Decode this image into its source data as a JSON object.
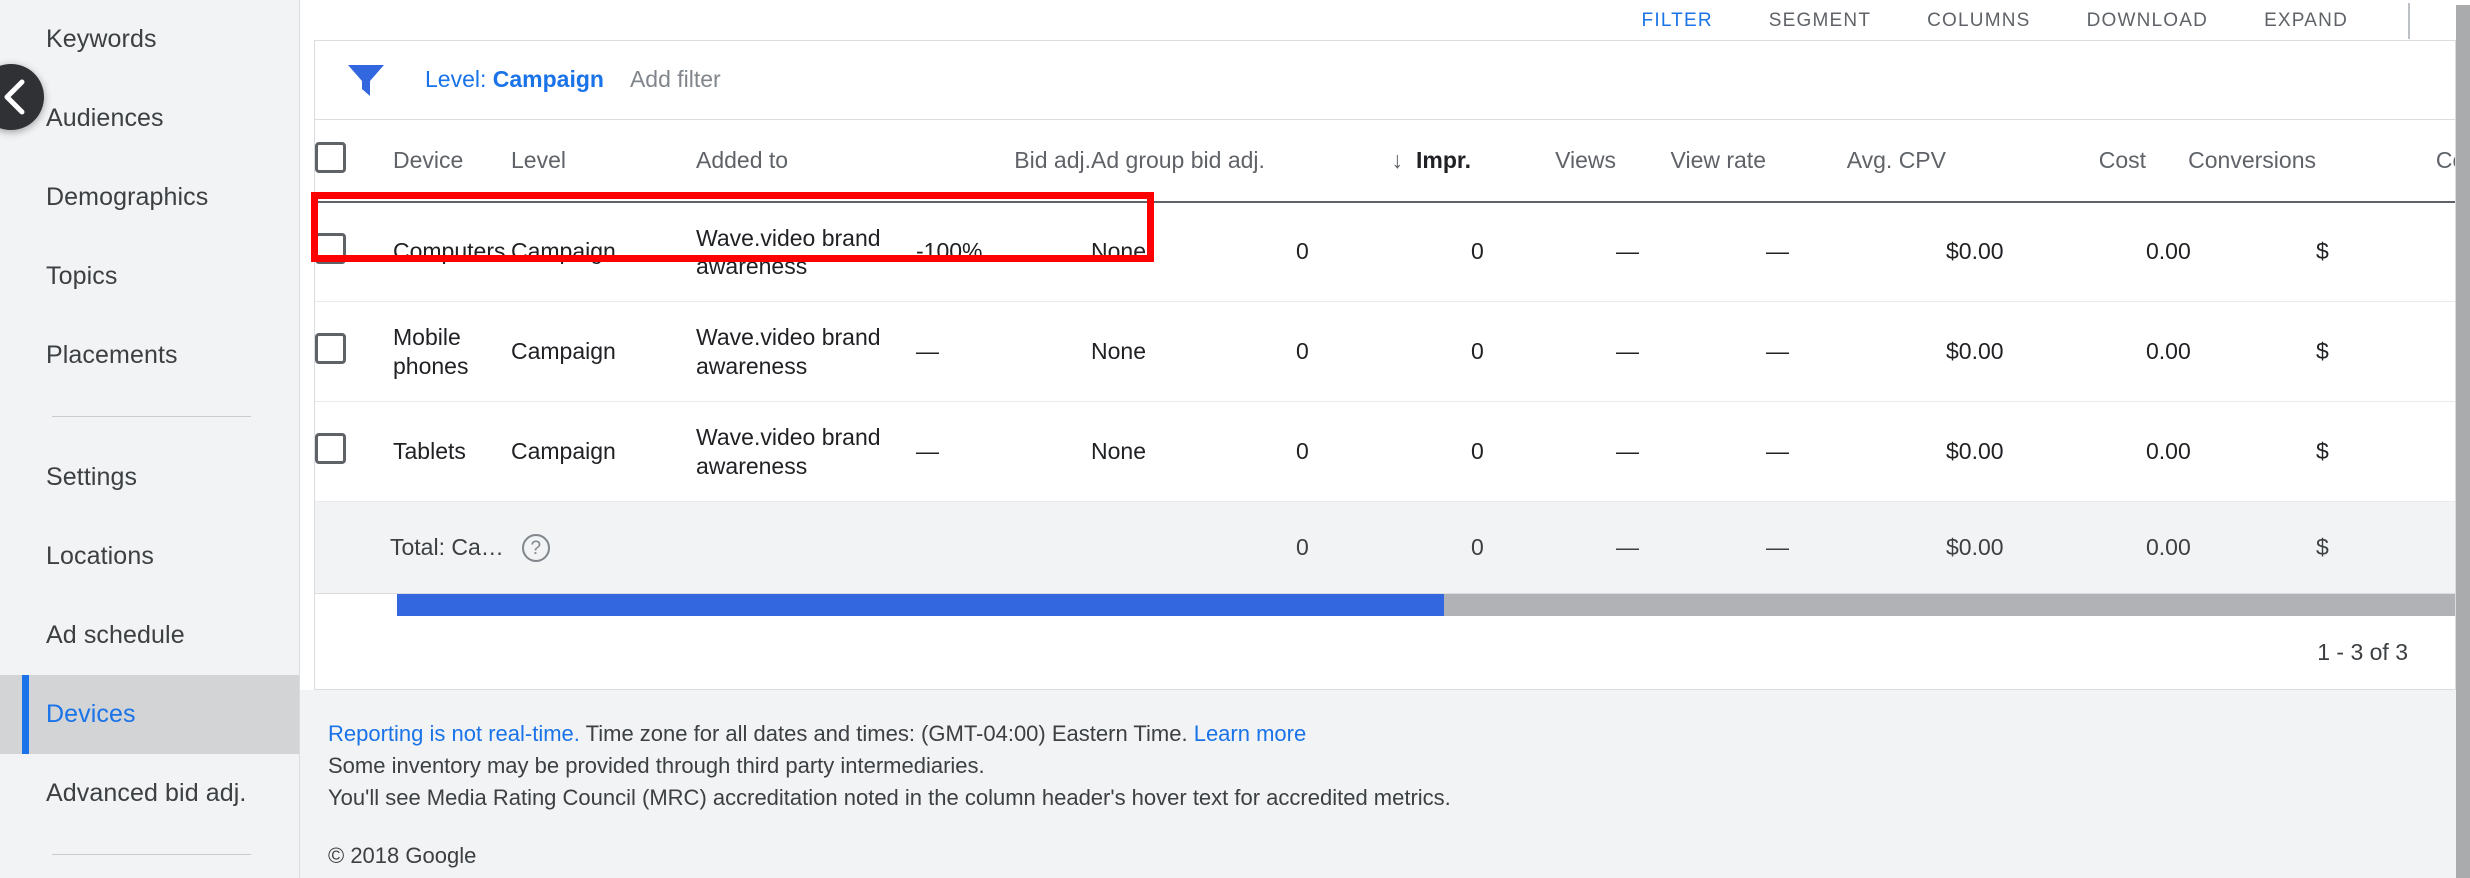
{
  "sidebar": {
    "collapse_icon": "chevron-left-icon",
    "items": [
      {
        "label": "Keywords",
        "active": false,
        "divider_after": false
      },
      {
        "label": "Audiences",
        "active": false,
        "divider_after": false
      },
      {
        "label": "Demographics",
        "active": false,
        "divider_after": false
      },
      {
        "label": "Topics",
        "active": false,
        "divider_after": false
      },
      {
        "label": "Placements",
        "active": false,
        "divider_after": true
      },
      {
        "label": "Settings",
        "active": false,
        "divider_after": false
      },
      {
        "label": "Locations",
        "active": false,
        "divider_after": false
      },
      {
        "label": "Ad schedule",
        "active": false,
        "divider_after": false
      },
      {
        "label": "Devices",
        "active": true,
        "divider_after": false
      },
      {
        "label": "Advanced bid adj.",
        "active": false,
        "divider_after": true
      }
    ]
  },
  "toolbar": {
    "buttons": [
      {
        "label": "FILTER",
        "accent": true
      },
      {
        "label": "SEGMENT",
        "accent": false
      },
      {
        "label": "COLUMNS",
        "accent": false
      },
      {
        "label": "DOWNLOAD",
        "accent": false
      },
      {
        "label": "EXPAND",
        "accent": false
      }
    ]
  },
  "filter_bar": {
    "funnel_icon": "filter-funnel-icon",
    "chip_prefix": "Level: ",
    "chip_value": "Campaign",
    "add_filter_label": "Add filter"
  },
  "table": {
    "sort_arrow": "↓",
    "columns": [
      {
        "key": "device",
        "label": "Device",
        "align": "left",
        "sorted": false
      },
      {
        "key": "level",
        "label": "Level",
        "align": "left",
        "sorted": false
      },
      {
        "key": "added_to",
        "label": "Added to",
        "align": "left",
        "sorted": false
      },
      {
        "key": "bid_adj",
        "label": "Bid adj.",
        "align": "right",
        "sorted": false
      },
      {
        "key": "ag_bid",
        "label": "Ad group bid adj.",
        "align": "left",
        "sorted": false
      },
      {
        "key": "impr",
        "label": "Impr.",
        "align": "right",
        "sorted": true
      },
      {
        "key": "views",
        "label": "Views",
        "align": "right",
        "sorted": false
      },
      {
        "key": "view_rate",
        "label": "View rate",
        "align": "right",
        "sorted": false
      },
      {
        "key": "avg_cpv",
        "label": "Avg. CPV",
        "align": "right",
        "sorted": false
      },
      {
        "key": "cost",
        "label": "Cost",
        "align": "right",
        "sorted": false
      },
      {
        "key": "conv",
        "label": "Conversions",
        "align": "right",
        "sorted": false
      },
      {
        "key": "cost_conv",
        "label": "Cost /",
        "align": "right",
        "sorted": false
      }
    ],
    "rows": [
      {
        "device": "Computers",
        "level": "Campaign",
        "added_to": "Wave.video brand awareness",
        "bid_adj": "-100%",
        "ag_bid": "None",
        "impr": "0",
        "views": "0",
        "view_rate": "—",
        "avg_cpv": "—",
        "cost": "$0.00",
        "conv": "0.00",
        "cost_conv": "$",
        "highlighted": true
      },
      {
        "device": "Mobile phones",
        "level": "Campaign",
        "added_to": "Wave.video brand awareness",
        "bid_adj": "—",
        "ag_bid": "None",
        "impr": "0",
        "views": "0",
        "view_rate": "—",
        "avg_cpv": "—",
        "cost": "$0.00",
        "conv": "0.00",
        "cost_conv": "$",
        "highlighted": false
      },
      {
        "device": "Tablets",
        "level": "Campaign",
        "added_to": "Wave.video brand awareness",
        "bid_adj": "—",
        "ag_bid": "None",
        "impr": "0",
        "views": "0",
        "view_rate": "—",
        "avg_cpv": "—",
        "cost": "$0.00",
        "conv": "0.00",
        "cost_conv": "$",
        "highlighted": false
      }
    ],
    "totals": {
      "label": "Total: Ca…",
      "help_icon": "help-circle-icon",
      "impr": "0",
      "views": "0",
      "view_rate": "—",
      "avg_cpv": "—",
      "cost": "$0.00",
      "conv": "0.00",
      "cost_conv": "$"
    }
  },
  "pagination": {
    "range_label": "1 - 3 of 3"
  },
  "footer": {
    "line1_link": "Reporting is not real-time.",
    "line1_text": " Time zone for all dates and times: (GMT-04:00) Eastern Time. ",
    "line1_learn_more": "Learn more",
    "line2": "Some inventory may be provided through third party intermediaries.",
    "line3": "You'll see Media Rating Council (MRC) accreditation noted in the column header's hover text for accredited metrics.",
    "copyright": "© 2018 Google"
  },
  "colors": {
    "accent_blue": "#1a73e8",
    "scrollbar_blue": "#3367e0",
    "annotation_red": "#ff0000",
    "sidebar_bg": "#f1f3f4",
    "active_bg": "#d2d4d6",
    "text_primary": "#202124",
    "text_secondary": "#5f6368"
  }
}
